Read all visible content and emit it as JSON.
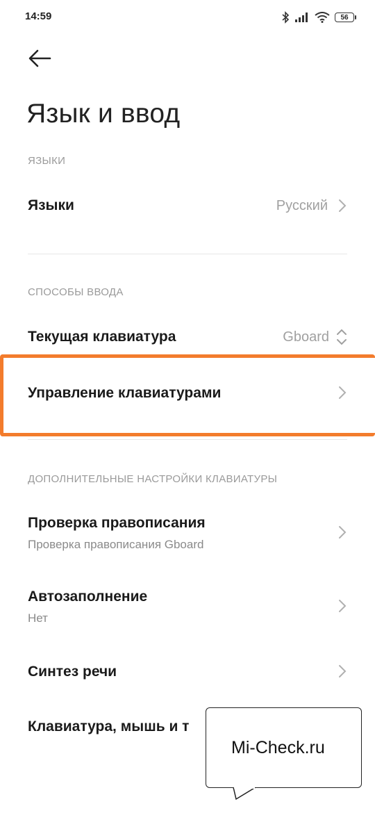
{
  "status_bar": {
    "time": "14:59",
    "battery": "56"
  },
  "header": {
    "title": "Язык и ввод"
  },
  "sections": {
    "languages": {
      "header": "ЯЗЫКИ",
      "rows": [
        {
          "title": "Языки",
          "value": "Русский"
        }
      ]
    },
    "input_methods": {
      "header": "СПОСОБЫ ВВОДА",
      "rows": [
        {
          "title": "Текущая клавиатура",
          "value": "Gboard"
        },
        {
          "title": "Управление клавиатурами"
        }
      ]
    },
    "keyboard_settings": {
      "header": "ДОПОЛНИТЕЛЬНЫЕ НАСТРОЙКИ КЛАВИАТУРЫ",
      "rows": [
        {
          "title": "Проверка правописания",
          "subtitle": "Проверка правописания Gboard"
        },
        {
          "title": "Автозаполнение",
          "subtitle": "Нет"
        },
        {
          "title": "Синтез речи"
        },
        {
          "title": "Клавиатура, мышь и т"
        }
      ]
    }
  },
  "watermark": {
    "text": "Mi-Check.ru"
  },
  "colors": {
    "highlight": "#f37c2c",
    "secondary_text": "#9a9a9a"
  },
  "icons": [
    "bluetooth-icon",
    "signal-icon",
    "wifi-icon",
    "battery-icon",
    "back-arrow-icon",
    "chevron-right-icon",
    "chevron-updown-icon"
  ]
}
